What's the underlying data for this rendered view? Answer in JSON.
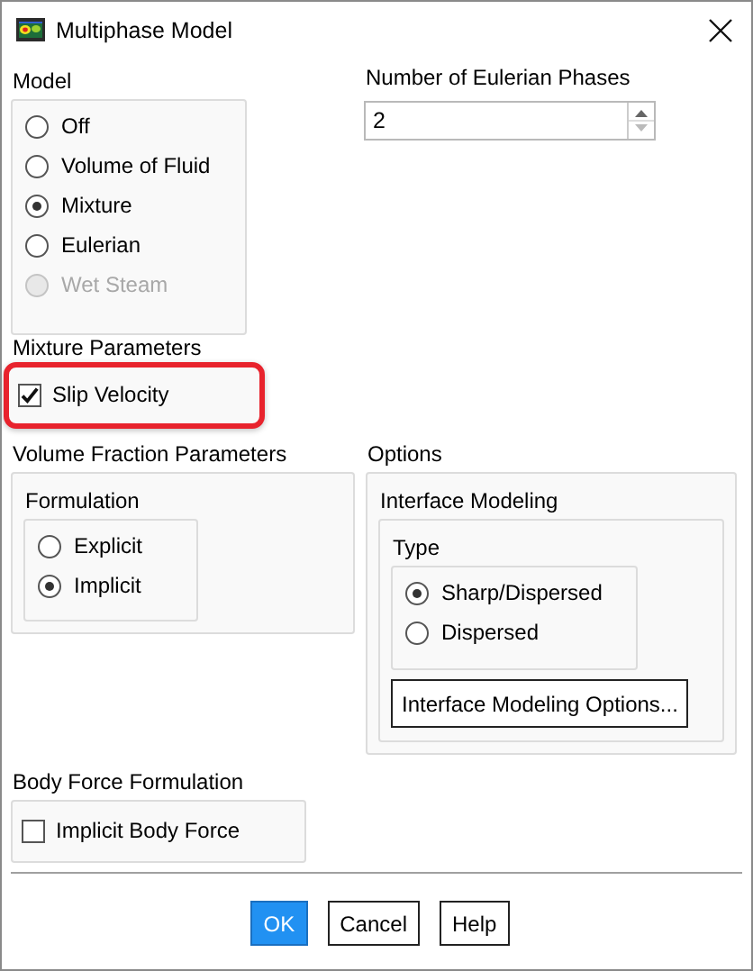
{
  "window": {
    "title": "Multiphase Model"
  },
  "model": {
    "label": "Model",
    "options": [
      {
        "label": "Off",
        "selected": false,
        "disabled": false
      },
      {
        "label": "Volume of Fluid",
        "selected": false,
        "disabled": false
      },
      {
        "label": "Mixture",
        "selected": true,
        "disabled": false
      },
      {
        "label": "Eulerian",
        "selected": false,
        "disabled": false
      },
      {
        "label": "Wet Steam",
        "selected": false,
        "disabled": true
      }
    ]
  },
  "eulerian_phases": {
    "label": "Number of Eulerian Phases",
    "value": "2"
  },
  "mixture_parameters": {
    "label": "Mixture Parameters",
    "slip_velocity": {
      "label": "Slip Velocity",
      "checked": true,
      "highlighted": true
    }
  },
  "volume_fraction_parameters": {
    "label": "Volume Fraction Parameters",
    "formulation": {
      "label": "Formulation",
      "options": [
        {
          "label": "Explicit",
          "selected": false
        },
        {
          "label": "Implicit",
          "selected": true
        }
      ]
    }
  },
  "options": {
    "label": "Options",
    "interface_modeling": {
      "label": "Interface Modeling",
      "type": {
        "label": "Type",
        "options": [
          {
            "label": "Sharp/Dispersed",
            "selected": true
          },
          {
            "label": "Dispersed",
            "selected": false
          }
        ]
      },
      "button": "Interface Modeling Options..."
    }
  },
  "body_force_formulation": {
    "label": "Body Force Formulation",
    "implicit_body_force": {
      "label": "Implicit Body Force",
      "checked": false
    }
  },
  "buttons": [
    {
      "label": "OK",
      "default": true
    },
    {
      "label": "Cancel",
      "default": false
    },
    {
      "label": "Help",
      "default": false
    }
  ]
}
